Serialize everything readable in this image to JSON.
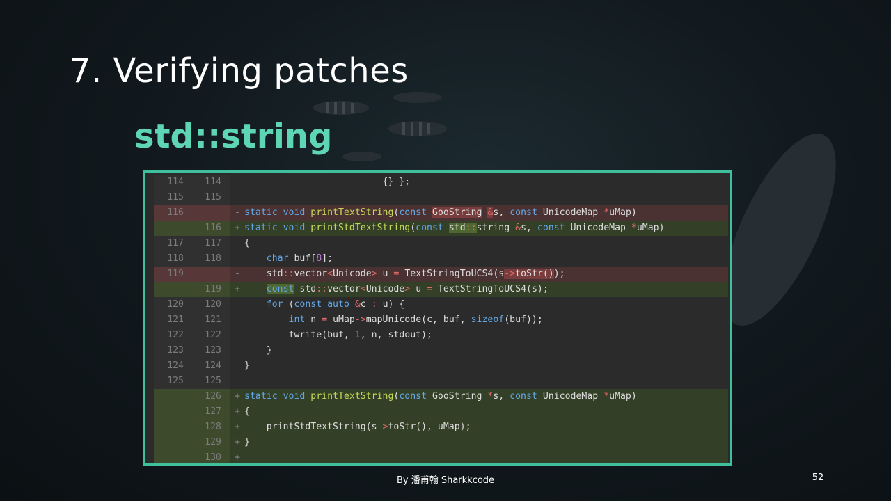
{
  "slide": {
    "title": "7. Verifying patches",
    "subtitle": "std::string",
    "footer": "By 潘甫翰 Sharkkcode",
    "page_number": "52"
  },
  "colors": {
    "accent": "#5fd6b3",
    "frame_border": "#3fbf9b",
    "removed_bg": "#4a3232",
    "added_bg": "#343f27"
  },
  "diff": {
    "lines": [
      {
        "type": "context",
        "old": "114",
        "new": "114",
        "marker": "",
        "code": [
          {
            "t": "                         {} };"
          }
        ]
      },
      {
        "type": "context",
        "old": "115",
        "new": "115",
        "marker": "",
        "code": []
      },
      {
        "type": "removed",
        "old": "116",
        "new": "",
        "marker": "-",
        "code": [
          {
            "t": "static void",
            "c": "kw"
          },
          {
            "t": " "
          },
          {
            "t": "printTextString",
            "c": "fn"
          },
          {
            "t": "("
          },
          {
            "t": "const",
            "c": "kw"
          },
          {
            "t": " "
          },
          {
            "t": "GooString",
            "c": "hl-rem"
          },
          {
            "t": " "
          },
          {
            "t": "&",
            "c": "op hl-rem"
          },
          {
            "t": "s, "
          },
          {
            "t": "const",
            "c": "kw"
          },
          {
            "t": " UnicodeMap "
          },
          {
            "t": "*",
            "c": "op"
          },
          {
            "t": "uMap)"
          }
        ]
      },
      {
        "type": "added",
        "old": "",
        "new": "116",
        "marker": "+",
        "code": [
          {
            "t": "static void",
            "c": "kw"
          },
          {
            "t": " printStd",
            "c": "fn"
          },
          {
            "t": "TextString",
            "c": "fn"
          },
          {
            "t": "("
          },
          {
            "t": "const",
            "c": "kw"
          },
          {
            "t": " "
          },
          {
            "t": "std",
            "c": "hl-add"
          },
          {
            "t": "::",
            "c": "op hl-add"
          },
          {
            "t": "string"
          },
          {
            "t": " "
          },
          {
            "t": "&",
            "c": "op"
          },
          {
            "t": "s, "
          },
          {
            "t": "const",
            "c": "kw"
          },
          {
            "t": " UnicodeMap "
          },
          {
            "t": "*",
            "c": "op"
          },
          {
            "t": "uMap)"
          }
        ]
      },
      {
        "type": "context",
        "old": "117",
        "new": "117",
        "marker": "",
        "code": [
          {
            "t": "{"
          }
        ]
      },
      {
        "type": "context",
        "old": "118",
        "new": "118",
        "marker": "",
        "code": [
          {
            "t": "    "
          },
          {
            "t": "char",
            "c": "kw"
          },
          {
            "t": " buf["
          },
          {
            "t": "8",
            "c": "num"
          },
          {
            "t": "];"
          }
        ]
      },
      {
        "type": "removed",
        "old": "119",
        "new": "",
        "marker": "-",
        "code": [
          {
            "t": "    std"
          },
          {
            "t": "::",
            "c": "op"
          },
          {
            "t": "vector"
          },
          {
            "t": "<",
            "c": "op"
          },
          {
            "t": "Unicode"
          },
          {
            "t": ">",
            "c": "op"
          },
          {
            "t": " u "
          },
          {
            "t": "=",
            "c": "op"
          },
          {
            "t": " TextStringToUCS4(s"
          },
          {
            "t": "->",
            "c": "op hl-rem"
          },
          {
            "t": "toStr()",
            "c": "hl-rem"
          },
          {
            "t": ");"
          }
        ]
      },
      {
        "type": "added",
        "old": "",
        "new": "119",
        "marker": "+",
        "code": [
          {
            "t": "    "
          },
          {
            "t": "const",
            "c": "kw hl-add"
          },
          {
            "t": " std"
          },
          {
            "t": "::",
            "c": "op"
          },
          {
            "t": "vector"
          },
          {
            "t": "<",
            "c": "op"
          },
          {
            "t": "Unicode"
          },
          {
            "t": ">",
            "c": "op"
          },
          {
            "t": " u "
          },
          {
            "t": "=",
            "c": "op"
          },
          {
            "t": " TextStringToUCS4(s);"
          }
        ]
      },
      {
        "type": "context",
        "old": "120",
        "new": "120",
        "marker": "",
        "code": [
          {
            "t": "    "
          },
          {
            "t": "for",
            "c": "kw"
          },
          {
            "t": " ("
          },
          {
            "t": "const auto",
            "c": "kw"
          },
          {
            "t": " "
          },
          {
            "t": "&",
            "c": "op"
          },
          {
            "t": "c "
          },
          {
            "t": ":",
            "c": "op"
          },
          {
            "t": " u) {"
          }
        ]
      },
      {
        "type": "context",
        "old": "121",
        "new": "121",
        "marker": "",
        "code": [
          {
            "t": "        "
          },
          {
            "t": "int",
            "c": "kw"
          },
          {
            "t": " n "
          },
          {
            "t": "=",
            "c": "op"
          },
          {
            "t": " uMap"
          },
          {
            "t": "->",
            "c": "op"
          },
          {
            "t": "mapUnicode(c, buf, "
          },
          {
            "t": "sizeof",
            "c": "kw"
          },
          {
            "t": "(buf));"
          }
        ]
      },
      {
        "type": "context",
        "old": "122",
        "new": "122",
        "marker": "",
        "code": [
          {
            "t": "        fwrite(buf, "
          },
          {
            "t": "1",
            "c": "num"
          },
          {
            "t": ", n, stdout);"
          }
        ]
      },
      {
        "type": "context",
        "old": "123",
        "new": "123",
        "marker": "",
        "code": [
          {
            "t": "    }"
          }
        ]
      },
      {
        "type": "context",
        "old": "124",
        "new": "124",
        "marker": "",
        "code": [
          {
            "t": "}"
          }
        ]
      },
      {
        "type": "context",
        "old": "125",
        "new": "125",
        "marker": "",
        "code": []
      },
      {
        "type": "added",
        "old": "",
        "new": "126",
        "marker": "+",
        "code": [
          {
            "t": "static void",
            "c": "kw"
          },
          {
            "t": " "
          },
          {
            "t": "printTextString",
            "c": "fn"
          },
          {
            "t": "("
          },
          {
            "t": "const",
            "c": "kw"
          },
          {
            "t": " GooString "
          },
          {
            "t": "*",
            "c": "op"
          },
          {
            "t": "s, "
          },
          {
            "t": "const",
            "c": "kw"
          },
          {
            "t": " UnicodeMap "
          },
          {
            "t": "*",
            "c": "op"
          },
          {
            "t": "uMap)"
          }
        ]
      },
      {
        "type": "added",
        "old": "",
        "new": "127",
        "marker": "+",
        "code": [
          {
            "t": "{"
          }
        ]
      },
      {
        "type": "added",
        "old": "",
        "new": "128",
        "marker": "+",
        "code": [
          {
            "t": "    printStdTextString(s"
          },
          {
            "t": "->",
            "c": "op"
          },
          {
            "t": "toStr(), uMap);"
          }
        ]
      },
      {
        "type": "added",
        "old": "",
        "new": "129",
        "marker": "+",
        "code": [
          {
            "t": "}"
          }
        ]
      },
      {
        "type": "added",
        "old": "",
        "new": "130",
        "marker": "+",
        "code": []
      }
    ]
  }
}
